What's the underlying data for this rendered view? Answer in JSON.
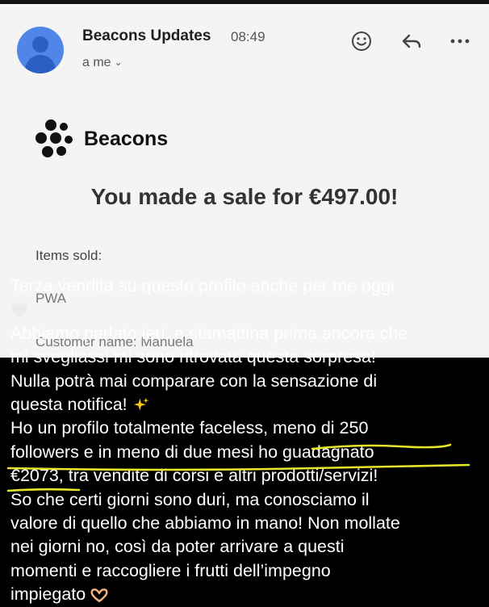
{
  "email": {
    "sender": "Beacons Updates",
    "time": "08:49",
    "recipient": "a me",
    "icons": [
      "emoji-icon",
      "reply-icon",
      "more-icon",
      "chevron-down-icon"
    ],
    "brand": "Beacons",
    "headline": "You made a sale for €497.00!",
    "items_label": "Items sold:",
    "partial_line_1": "PWA",
    "partial_line_2": "Customer name: Manuela"
  },
  "caption": {
    "lines": [
      "Terza vendita su questo profilo anche per me oggi",
      "Abbiamo parlato ieri, e stamattina prima ancora che",
      "mi svegliassi mi sono ritrovata questa sorpresa!",
      "Nulla potrà mai comparare con la sensazione di",
      "questa notifica!",
      "Ho un profilo totalmente faceless, meno di 250",
      "followers e in meno di due mesi ho guadagnato",
      "€2073, tra vendite di corsi e altri prodotti/servizi!",
      "So che certi giorni sono duri, ma conosciamo il",
      "valore di quello che abbiamo in mano! Non mollate",
      "nei giorni no, così da poter arrivare a questi",
      "momenti e raccogliere i frutti dell’impegno",
      "impiegato"
    ],
    "emojis": [
      "white-heart",
      "sparkles",
      "heart-hands"
    ],
    "highlight_color": "#e6e62a"
  }
}
